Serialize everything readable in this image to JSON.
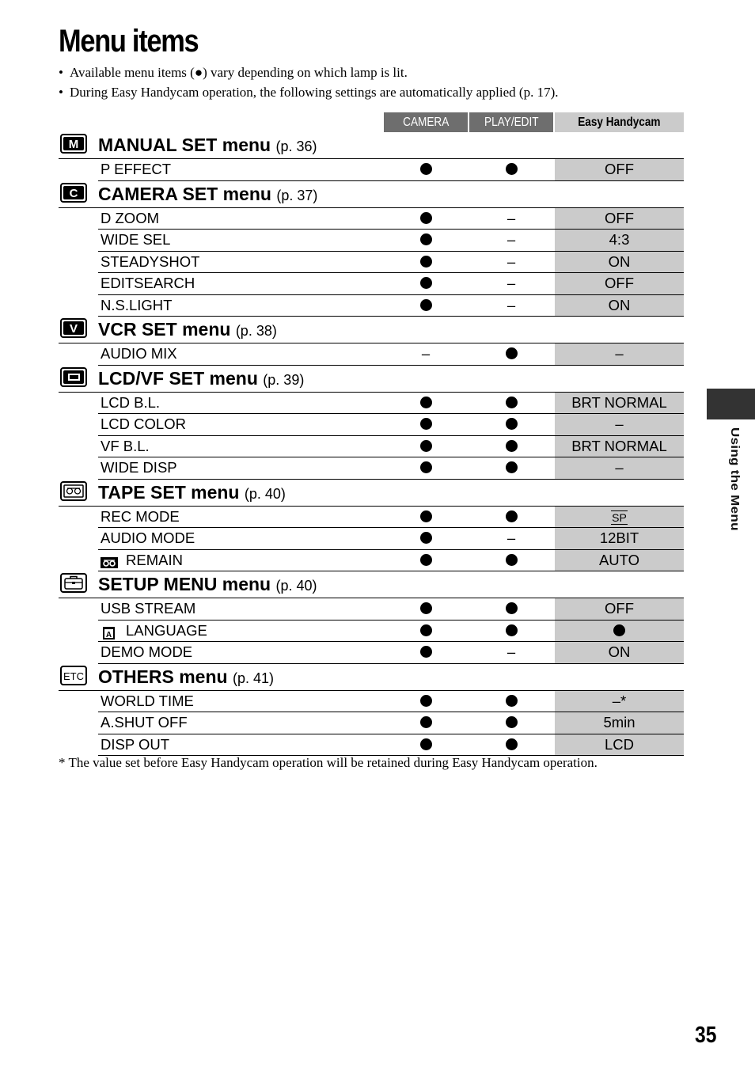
{
  "title": "Menu items",
  "bullets": [
    "Available menu items (●) vary depending on which lamp is lit.",
    "During Easy Handycam operation, the following settings are automatically applied (p. 17)."
  ],
  "columns": {
    "camera": "CAMERA",
    "play_edit": "PLAY/EDIT",
    "easy_handycam": "Easy Handycam"
  },
  "colors": {
    "header_dark": "#6e6e6e",
    "easy_column": "#cbcbcb",
    "side_tab": "#333333"
  },
  "sections": [
    {
      "icon": "manual-set-icon",
      "name": "MANUAL SET menu",
      "page": "(p. 36)",
      "rows": [
        {
          "label": "P EFFECT",
          "camera": "dot",
          "play": "dot",
          "easy": "OFF"
        }
      ]
    },
    {
      "icon": "camera-set-icon",
      "name": "CAMERA SET menu",
      "page": "(p. 37)",
      "rows": [
        {
          "label": "D ZOOM",
          "camera": "dot",
          "play": "–",
          "easy": "OFF"
        },
        {
          "label": "WIDE SEL",
          "camera": "dot",
          "play": "–",
          "easy": "4:3"
        },
        {
          "label": "STEADYSHOT",
          "camera": "dot",
          "play": "–",
          "easy": "ON"
        },
        {
          "label": "EDITSEARCH",
          "camera": "dot",
          "play": "–",
          "easy": "OFF"
        },
        {
          "label": "N.S.LIGHT",
          "camera": "dot",
          "play": "–",
          "easy": "ON"
        }
      ]
    },
    {
      "icon": "vcr-set-icon",
      "name": "VCR SET menu",
      "page": "(p. 38)",
      "rows": [
        {
          "label": "AUDIO MIX",
          "camera": "–",
          "play": "dot",
          "easy": "–"
        }
      ]
    },
    {
      "icon": "lcd-vf-set-icon",
      "name": "LCD/VF SET menu",
      "page": "(p. 39)",
      "rows": [
        {
          "label": "LCD B.L.",
          "camera": "dot",
          "play": "dot",
          "easy": "BRT NORMAL"
        },
        {
          "label": "LCD COLOR",
          "camera": "dot",
          "play": "dot",
          "easy": "–"
        },
        {
          "label": "VF B.L.",
          "camera": "dot",
          "play": "dot",
          "easy": "BRT NORMAL"
        },
        {
          "label": "WIDE DISP",
          "camera": "dot",
          "play": "dot",
          "easy": "–"
        }
      ]
    },
    {
      "icon": "tape-set-icon",
      "name": "TAPE SET menu",
      "page": "(p. 40)",
      "rows": [
        {
          "label": "REC MODE",
          "camera": "dot",
          "play": "dot",
          "easy": "SP",
          "easy_style": "sp"
        },
        {
          "label": "AUDIO MODE",
          "camera": "dot",
          "play": "–",
          "easy": "12BIT"
        },
        {
          "label": "REMAIN",
          "label_icon": "tape-remain-icon",
          "camera": "dot",
          "play": "dot",
          "easy": "AUTO"
        }
      ]
    },
    {
      "icon": "setup-menu-icon",
      "name": "SETUP MENU menu",
      "page": "(p. 40)",
      "rows": [
        {
          "label": "USB STREAM",
          "camera": "dot",
          "play": "dot",
          "easy": "OFF"
        },
        {
          "label": "LANGUAGE",
          "label_icon": "language-icon",
          "camera": "dot",
          "play": "dot",
          "easy": "dot"
        },
        {
          "label": "DEMO MODE",
          "camera": "dot",
          "play": "–",
          "easy": "ON"
        }
      ]
    },
    {
      "icon": "others-etc-icon",
      "name": "OTHERS menu",
      "page": "(p. 41)",
      "rows": [
        {
          "label": "WORLD TIME",
          "camera": "dot",
          "play": "dot",
          "easy": "–*"
        },
        {
          "label": "A.SHUT OFF",
          "camera": "dot",
          "play": "dot",
          "easy": "5min"
        },
        {
          "label": "DISP OUT",
          "camera": "dot",
          "play": "dot",
          "easy": "LCD"
        }
      ]
    }
  ],
  "footnote": "* The value set before Easy Handycam operation will be retained during Easy Handycam operation.",
  "side_tab_label": "Using the Menu",
  "page_number": "35"
}
